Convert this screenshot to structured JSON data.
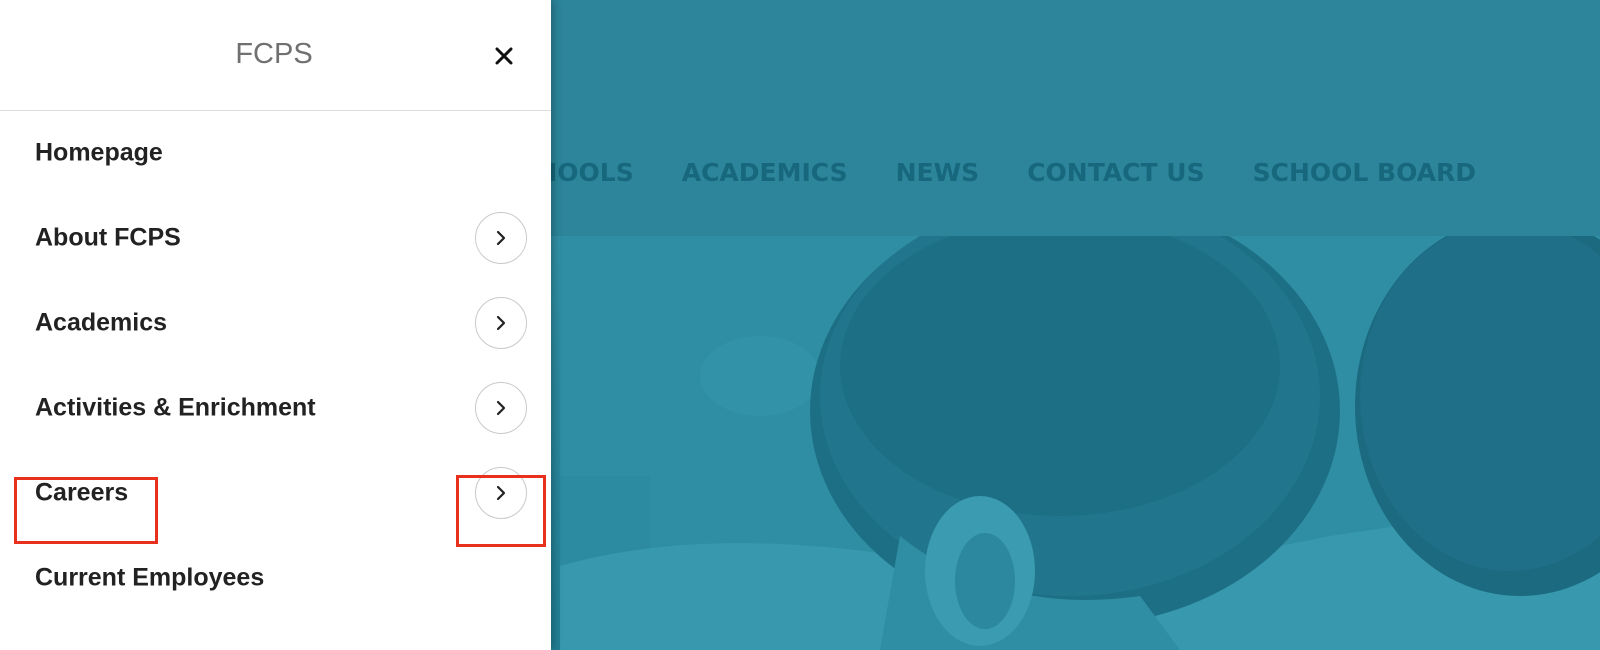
{
  "background_site": {
    "nav": [
      "SCHOOLS",
      "ACADEMICS",
      "NEWS",
      "CONTACT US",
      "SCHOOL BOARD"
    ],
    "overlay_color": "#2a8399"
  },
  "drawer": {
    "title": "FCPS",
    "close_icon": "close-icon",
    "items": [
      {
        "label": "Homepage",
        "has_submenu": false
      },
      {
        "label": "About FCPS",
        "has_submenu": true
      },
      {
        "label": "Academics",
        "has_submenu": true
      },
      {
        "label": "Activities & Enrichment",
        "has_submenu": true
      },
      {
        "label": "Careers",
        "has_submenu": true,
        "highlighted": true
      },
      {
        "label": "Current Employees",
        "has_submenu": false
      }
    ],
    "expand_icon": "chevron-right-icon"
  },
  "colors": {
    "highlight": "#e8301c",
    "menu_text": "#222222",
    "title_text": "#707070",
    "nav_text": "#17677d"
  }
}
